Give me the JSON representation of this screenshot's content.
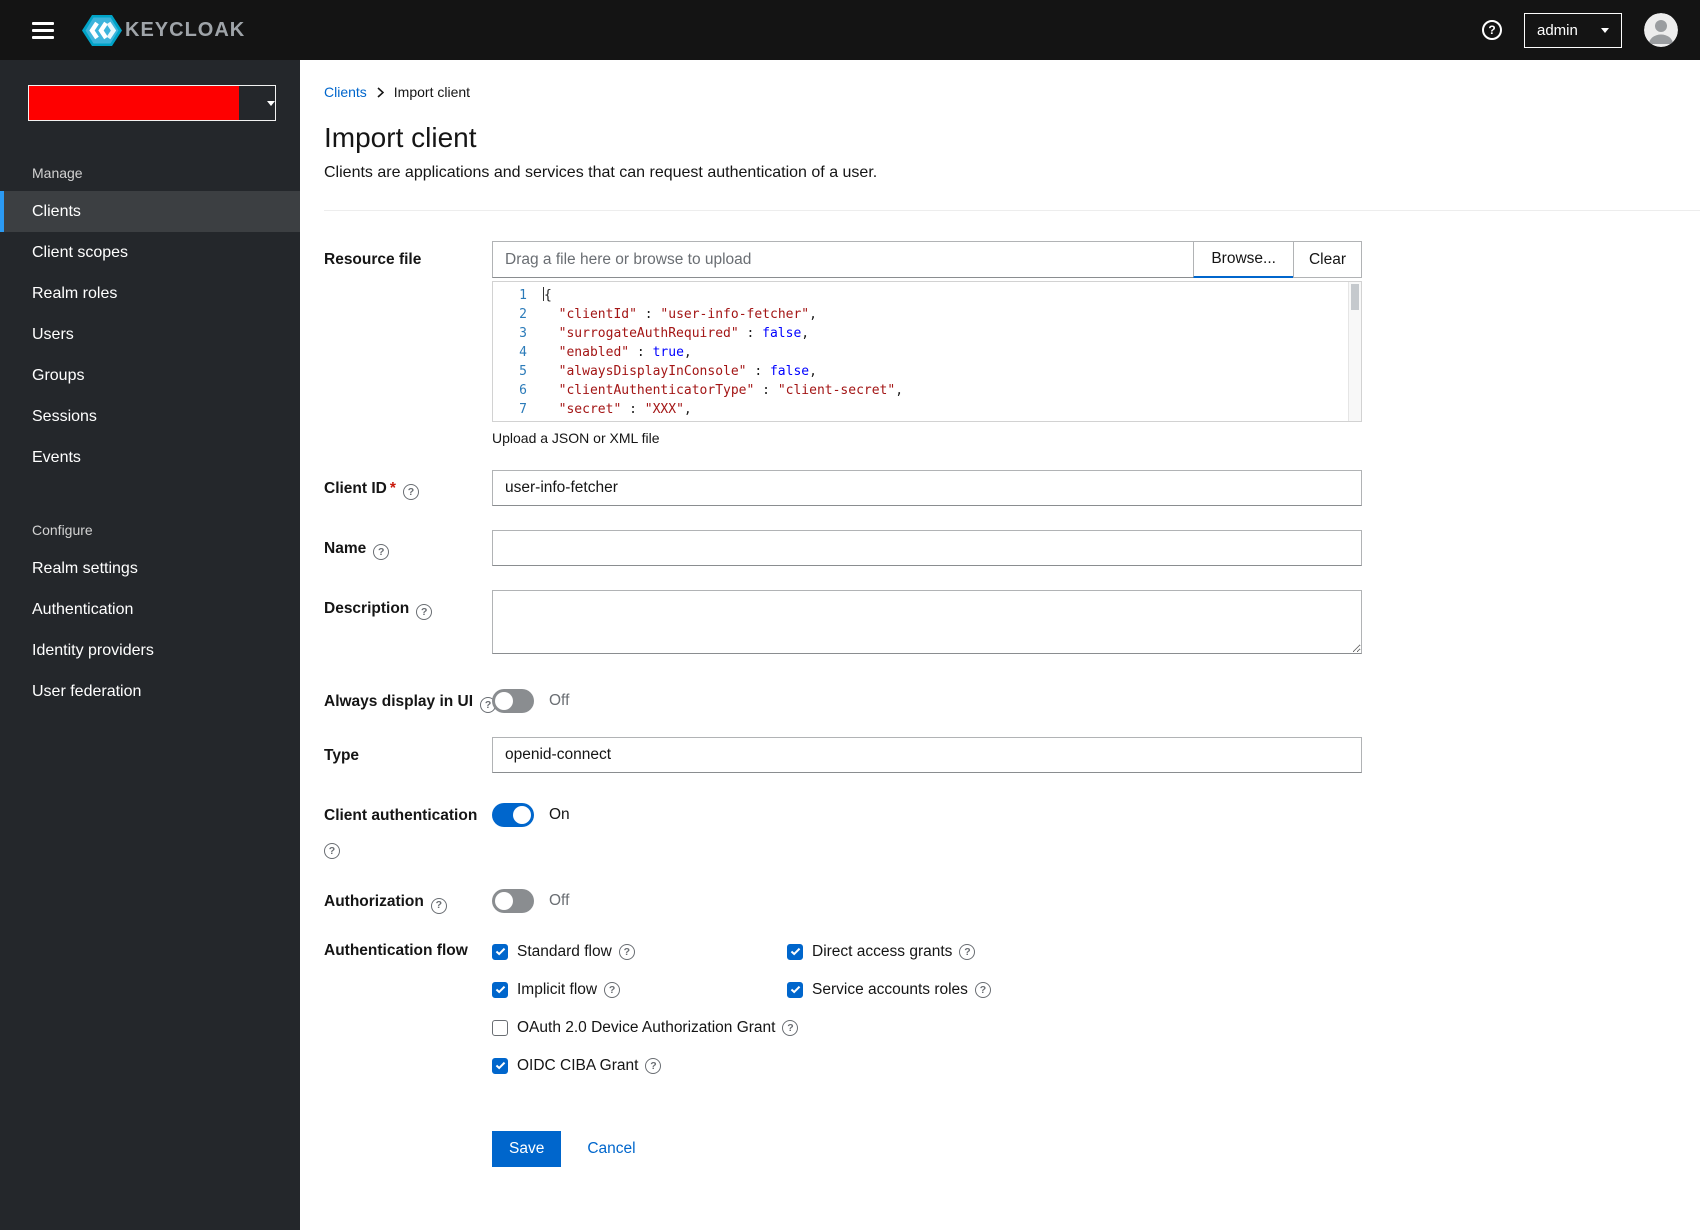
{
  "icons": {
    "help": "?"
  },
  "colors": {
    "accent": "#0066cc",
    "nav_indicator": "#2b9af3",
    "redaction": "#fe0000"
  },
  "topbar": {
    "brand": "KEYCLOAK",
    "user_menu": "admin"
  },
  "sidebar": {
    "selected_item": "Clients",
    "sections": [
      {
        "label": "Manage",
        "items": [
          "Clients",
          "Client scopes",
          "Realm roles",
          "Users",
          "Groups",
          "Sessions",
          "Events"
        ]
      },
      {
        "label": "Configure",
        "items": [
          "Realm settings",
          "Authentication",
          "Identity providers",
          "User federation"
        ]
      }
    ]
  },
  "breadcrumb": {
    "parent": "Clients",
    "current": "Import client"
  },
  "page": {
    "title": "Import client",
    "subtitle": "Clients are applications and services that can request authentication of a user."
  },
  "form": {
    "resource_file": {
      "label": "Resource file",
      "placeholder": "Drag a file here or browse to upload",
      "browse_label": "Browse...",
      "clear_label": "Clear",
      "helper": "Upload a JSON or XML file",
      "code_lines": [
        {
          "n": "1",
          "caret": true,
          "tokens": [
            {
              "t": "{",
              "c": "p"
            }
          ]
        },
        {
          "n": "2",
          "tokens": [
            {
              "t": "  ",
              "c": "p"
            },
            {
              "t": "\"clientId\"",
              "c": "s"
            },
            {
              "t": " : ",
              "c": "p"
            },
            {
              "t": "\"user-info-fetcher\"",
              "c": "s"
            },
            {
              "t": ",",
              "c": "p"
            }
          ]
        },
        {
          "n": "3",
          "tokens": [
            {
              "t": "  ",
              "c": "p"
            },
            {
              "t": "\"surrogateAuthRequired\"",
              "c": "s"
            },
            {
              "t": " : ",
              "c": "p"
            },
            {
              "t": "false",
              "c": "b"
            },
            {
              "t": ",",
              "c": "p"
            }
          ]
        },
        {
          "n": "4",
          "tokens": [
            {
              "t": "  ",
              "c": "p"
            },
            {
              "t": "\"enabled\"",
              "c": "s"
            },
            {
              "t": " : ",
              "c": "p"
            },
            {
              "t": "true",
              "c": "b"
            },
            {
              "t": ",",
              "c": "p"
            }
          ]
        },
        {
          "n": "5",
          "tokens": [
            {
              "t": "  ",
              "c": "p"
            },
            {
              "t": "\"alwaysDisplayInConsole\"",
              "c": "s"
            },
            {
              "t": " : ",
              "c": "p"
            },
            {
              "t": "false",
              "c": "b"
            },
            {
              "t": ",",
              "c": "p"
            }
          ]
        },
        {
          "n": "6",
          "tokens": [
            {
              "t": "  ",
              "c": "p"
            },
            {
              "t": "\"clientAuthenticatorType\"",
              "c": "s"
            },
            {
              "t": " : ",
              "c": "p"
            },
            {
              "t": "\"client-secret\"",
              "c": "s"
            },
            {
              "t": ",",
              "c": "p"
            }
          ]
        },
        {
          "n": "7",
          "tokens": [
            {
              "t": "  ",
              "c": "p"
            },
            {
              "t": "\"secret\"",
              "c": "s"
            },
            {
              "t": " : ",
              "c": "p"
            },
            {
              "t": "\"XXX\"",
              "c": "s"
            },
            {
              "t": ",",
              "c": "p"
            }
          ]
        }
      ]
    },
    "client_id": {
      "label": "Client ID",
      "required": "*",
      "value": "user-info-fetcher"
    },
    "name": {
      "label": "Name",
      "value": ""
    },
    "description": {
      "label": "Description",
      "value": ""
    },
    "always_display": {
      "label": "Always display in UI",
      "state": "Off"
    },
    "type": {
      "label": "Type",
      "value": "openid-connect"
    },
    "client_auth": {
      "label": "Client authentication",
      "state": "On"
    },
    "authorization": {
      "label": "Authorization",
      "state": "Off"
    },
    "auth_flow": {
      "label": "Authentication flow",
      "options": [
        {
          "label": "Standard flow",
          "checked": true,
          "wide": false
        },
        {
          "label": "Direct access grants",
          "checked": true,
          "wide": false
        },
        {
          "label": "Implicit flow",
          "checked": true,
          "wide": false
        },
        {
          "label": "Service accounts roles",
          "checked": true,
          "wide": false
        },
        {
          "label": "OAuth 2.0 Device Authorization Grant",
          "checked": false,
          "wide": true
        },
        {
          "label": "OIDC CIBA Grant",
          "checked": true,
          "wide": true
        }
      ]
    },
    "actions": {
      "save": "Save",
      "cancel": "Cancel"
    }
  }
}
